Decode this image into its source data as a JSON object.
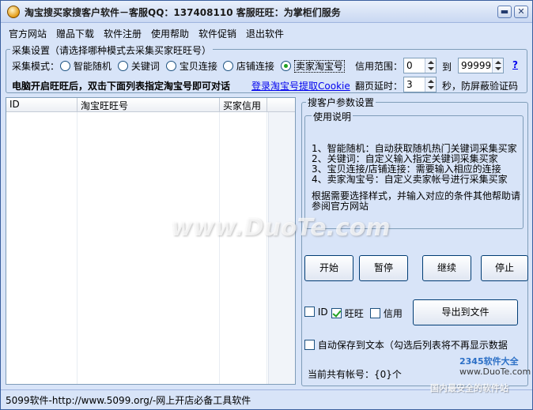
{
  "window": {
    "title": "淘宝搜买家搜客户软件－客服QQ：137408110 客服旺旺：为掌柜们服务",
    "minimize_label": "▬",
    "close_label": "✕"
  },
  "menu": {
    "items": [
      "官方网站",
      "赠品下载",
      "软件注册",
      "使用帮助",
      "软件促销",
      "退出软件"
    ]
  },
  "collect": {
    "group_label": "采集设置（请选择哪种模式去采集买家旺旺号）",
    "mode_label": "采集模式：",
    "modes": [
      "智能随机",
      "关键词",
      "宝贝连接",
      "店铺连接",
      "卖家淘宝号"
    ],
    "selected_mode": "卖家淘宝号",
    "range_label": "信用范围：",
    "range_from": "0",
    "range_to_label": "到",
    "range_to": "99999",
    "help_label": "?",
    "hint": "电脑开启旺旺后，双击下面列表指定淘宝号即可对话",
    "login_link": "登录淘宝号提取Cookie",
    "delay_label": "翻页延时：",
    "delay_value": "3",
    "delay_suffix": "秒，防屏蔽验证码"
  },
  "table": {
    "columns": [
      "ID",
      "淘宝旺旺号",
      "买家信用"
    ],
    "rows": []
  },
  "params": {
    "group_label": "搜客户参数设置",
    "usage_label": "使用说明",
    "usage_lines": [
      "1、智能随机：自动获取随机热门关键词采集买家",
      "2、关键词：自定义输入指定关键词采集买家",
      "3、宝贝连接/店铺连接：需要输入相应的连接",
      "4、卖家淘宝号：自定义卖家帐号进行采集买家"
    ],
    "usage_tip_1": "根据需要选择样式，并输入对应的条件其他帮助请",
    "usage_tip_2": "参阅官方网站"
  },
  "actions": {
    "start": "开始",
    "pause": "暂停",
    "continue": "继续",
    "stop": "停止",
    "export": "导出到文件"
  },
  "export_fields": {
    "id_label": "ID",
    "id_checked": false,
    "wangwang_label": "旺旺",
    "wangwang_checked": true,
    "credit_label": "信用",
    "credit_checked": false
  },
  "autosave": {
    "label": "自动保存到文本（勾选后列表将不再显示数据",
    "checked": false
  },
  "count": {
    "text": "当前共有帐号：{0}个"
  },
  "status": {
    "text": "5099软件-http://www.5099.org/-网上开店必备工具软件"
  },
  "watermarks": {
    "center": "www.DuoTe.com",
    "corner_brand": "2345软件大全",
    "corner_url": "www.DuoTe.com",
    "corner_tag": "国内最安全的软件站"
  }
}
